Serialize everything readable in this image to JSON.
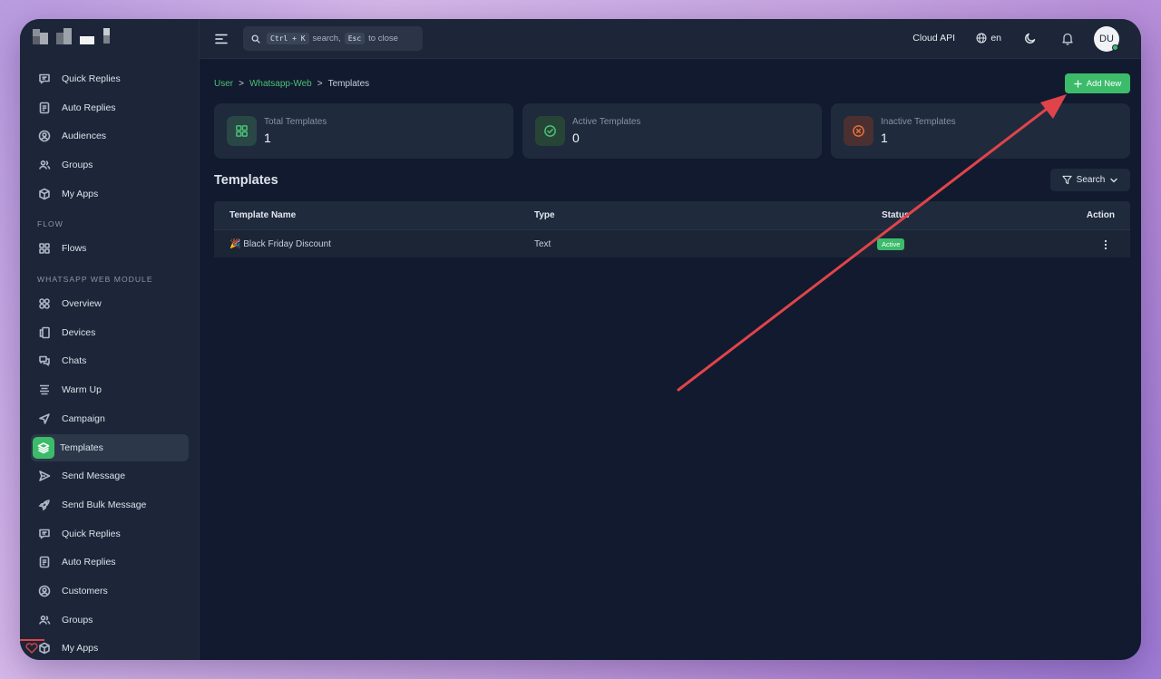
{
  "sidebar": {
    "items_top": [
      {
        "label": "Quick Replies",
        "icon": "message-square-icon"
      },
      {
        "label": "Auto Replies",
        "icon": "file-text-icon"
      },
      {
        "label": "Audiences",
        "icon": "user-circle-icon"
      },
      {
        "label": "Groups",
        "icon": "users-icon"
      },
      {
        "label": "My Apps",
        "icon": "box-icon"
      }
    ],
    "section_flow": "FLOW",
    "flow_items": [
      {
        "label": "Flows",
        "icon": "grid-icon"
      }
    ],
    "section_module": "WHATSAPP WEB MODULE",
    "module_items": [
      {
        "label": "Overview",
        "icon": "circles-icon"
      },
      {
        "label": "Devices",
        "icon": "devices-icon"
      },
      {
        "label": "Chats",
        "icon": "chat-icon"
      },
      {
        "label": "Warm Up",
        "icon": "server-icon"
      },
      {
        "label": "Campaign",
        "icon": "navigation-icon"
      },
      {
        "label": "Templates",
        "icon": "layers-icon",
        "active": true
      },
      {
        "label": "Send Message",
        "icon": "send-icon"
      },
      {
        "label": "Send Bulk Message",
        "icon": "rocket-icon"
      },
      {
        "label": "Quick Replies",
        "icon": "message-square-icon"
      },
      {
        "label": "Auto Replies",
        "icon": "file-text-icon"
      },
      {
        "label": "Customers",
        "icon": "user-circle-icon"
      },
      {
        "label": "Groups",
        "icon": "users-icon"
      },
      {
        "label": "My Apps",
        "icon": "box-icon"
      }
    ]
  },
  "topbar": {
    "search_hint_kbd1": "Ctrl + K",
    "search_hint_text1": "search,",
    "search_hint_kbd2": "Esc",
    "search_hint_text2": "to close",
    "cloud_api": "Cloud API",
    "language": "en",
    "avatar_initials": "DU"
  },
  "breadcrumb": {
    "level1": "User",
    "level2": "Whatsapp-Web",
    "current": "Templates",
    "separator": ">"
  },
  "add_new_label": "Add New",
  "stats": [
    {
      "label": "Total Templates",
      "value": "1",
      "color": "#4cc077",
      "bg": "#284745",
      "icon": "grid-icon"
    },
    {
      "label": "Active Templates",
      "value": "0",
      "color": "#4cc077",
      "bg": "#264537",
      "icon": "check-circle-icon"
    },
    {
      "label": "Inactive Templates",
      "value": "1",
      "color": "#e4703f",
      "bg": "#4a3030",
      "icon": "x-circle-icon"
    }
  ],
  "templates_heading": "Templates",
  "filter_label": "Search",
  "table": {
    "headers": {
      "name": "Template Name",
      "type": "Type",
      "status": "Status",
      "action": "Action"
    },
    "rows": [
      {
        "name": "🎉 Black Friday Discount",
        "type": "Text",
        "status": "Active"
      }
    ]
  },
  "colors": {
    "accent": "#3cbc6a",
    "annotation_arrow": "#e0444a"
  }
}
